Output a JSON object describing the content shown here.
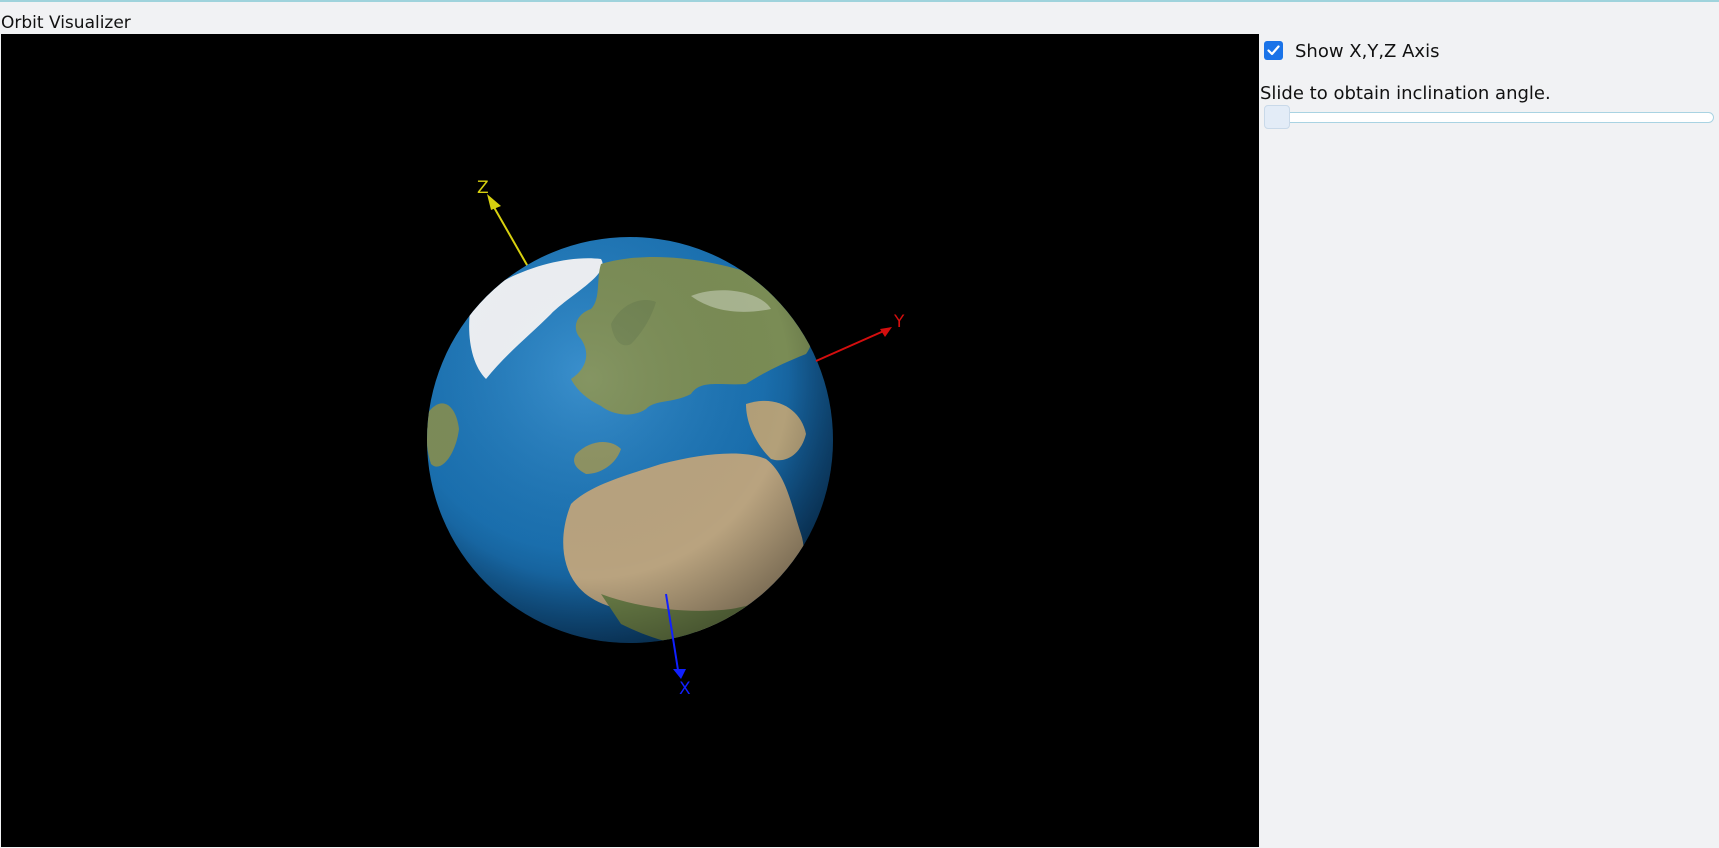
{
  "app": {
    "title": "Orbit Visualizer"
  },
  "scene": {
    "background_color": "#000000",
    "globe": {
      "ocean_color": "#1a6fae",
      "land_color": "#7f8f5c",
      "desert_color": "#b9a37f",
      "ice_color": "#f2f4f7"
    },
    "axes": {
      "x": {
        "label": "X",
        "color": "#1020ff"
      },
      "y": {
        "label": "Y",
        "color": "#d40e0e"
      },
      "z": {
        "label": "Z",
        "color": "#d8d10f"
      }
    }
  },
  "controls": {
    "show_axis": {
      "label": "Show X,Y,Z Axis",
      "checked": true
    },
    "inclination": {
      "caption": "Slide to obtain inclination angle.",
      "value": 0
    }
  },
  "colors": {
    "accent": "#1a73e8",
    "panel_background": "#f1f2f4"
  }
}
